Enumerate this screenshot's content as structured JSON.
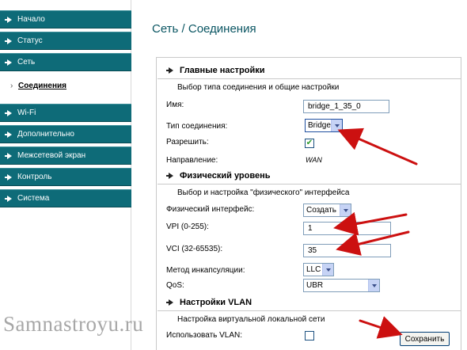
{
  "sidebar": {
    "items": [
      {
        "label": "Начало"
      },
      {
        "label": "Статус"
      },
      {
        "label": "Сеть"
      },
      {
        "label": "Wi-Fi"
      },
      {
        "label": "Дополнительно"
      },
      {
        "label": "Межсетевой экран"
      },
      {
        "label": "Контроль"
      },
      {
        "label": "Система"
      }
    ],
    "sub_item": "Соединения",
    "sub_bullet": "›"
  },
  "page_title": "Сеть / Соединения",
  "main_settings": {
    "title": "Главные настройки",
    "description": "Выбор типа соединения и общие настройки",
    "name_label": "Имя:",
    "name_value": "bridge_1_35_0",
    "conn_type_label": "Тип соединения:",
    "conn_type_value": "Bridge",
    "enable_label": "Разрешить:",
    "enable_checked": true,
    "direction_label": "Направление:",
    "direction_value": "WAN"
  },
  "physical": {
    "title": "Физический уровень",
    "description": "Выбор и настройка \"физического\" интерфейса",
    "iface_label": "Физический интерфейс:",
    "iface_value": "Создать",
    "vpi_label": "VPI (0-255):",
    "vpi_value": "1",
    "vci_label": "VCI (32-65535):",
    "vci_value": "35",
    "encap_label": "Метод инкапсуляции:",
    "encap_value": "LLC",
    "qos_label": "QoS:",
    "qos_value": "UBR"
  },
  "vlan": {
    "title": "Настройки VLAN",
    "description": "Настройка виртуальной локальной сети",
    "use_vlan_label": "Использовать VLAN:",
    "use_vlan_checked": false
  },
  "save_label": "Сохранить",
  "watermark": "Samnastroyu.ru",
  "colors": {
    "nav": "#0e6b78",
    "title": "#0b5663",
    "annotation": "#cc1010"
  }
}
